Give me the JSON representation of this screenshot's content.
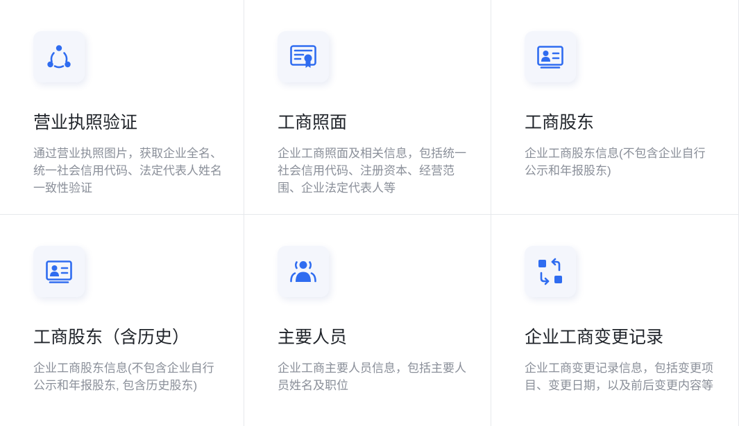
{
  "colors": {
    "accent": "#2f6cf0",
    "title": "#1f2329",
    "desc": "#8a8f99",
    "icon_bg": "#f4f6fc",
    "divider": "#e6e8ec"
  },
  "cards": [
    {
      "icon": "circle-nodes-icon",
      "title": "营业执照验证",
      "desc": "通过营业执照图片，获取企业全名、统一社会信用代码、法定代表人姓名一致性验证"
    },
    {
      "icon": "certificate-icon",
      "title": "工商照面",
      "desc": "企业工商照面及相关信息，包括统一社会信用代码、注册资本、经营范围、企业法定代表人等"
    },
    {
      "icon": "id-card-icon",
      "title": "工商股东",
      "desc": "企业工商股东信息(不包含企业自行公示和年报股东)"
    },
    {
      "icon": "id-card-icon",
      "title": "工商股东（含历史）",
      "desc": "企业工商股东信息(不包含企业自行公示和年报股东, 包含历史股东)"
    },
    {
      "icon": "users-icon",
      "title": "主要人员",
      "desc": "企业工商主要人员信息，包括主要人员姓名及职位"
    },
    {
      "icon": "swap-icon",
      "title": "企业工商变更记录",
      "desc": "企业工商变更记录信息，包括变更项目、变更日期，以及前后变更内容等"
    }
  ]
}
